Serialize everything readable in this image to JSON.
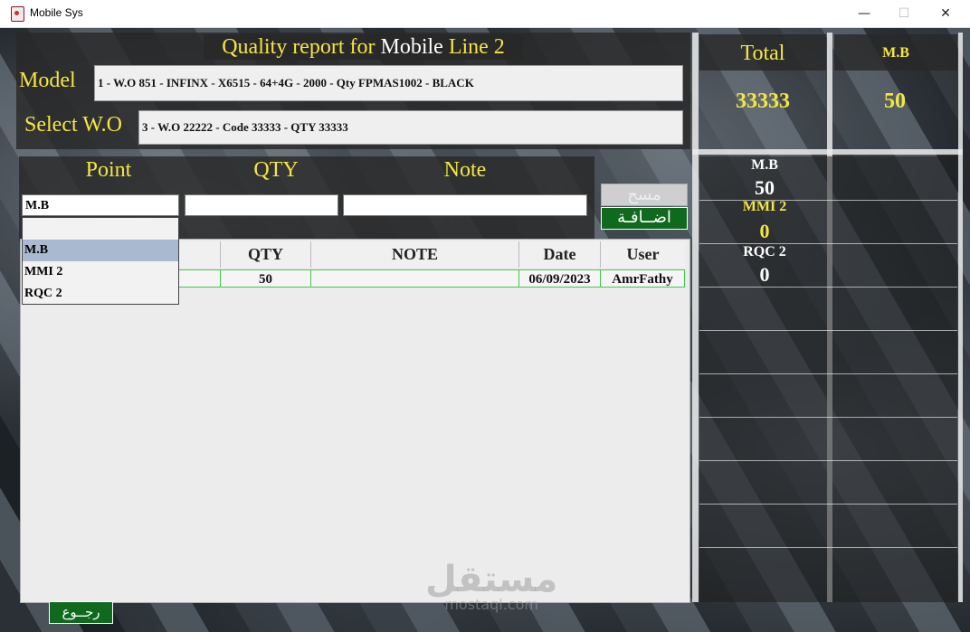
{
  "window": {
    "title": "Mobile Sys",
    "minimize": "—",
    "maximize": "☐",
    "close": "✕"
  },
  "header": {
    "part1": "Quality report for ",
    "part2": "Mobile",
    "part3": " Line 2"
  },
  "model": {
    "label": "Model",
    "value": "1 - W.O 851 -  INFINX - X6515 - 64+4G - 2000 - Qty FPMAS1002 - BLACK"
  },
  "wo": {
    "label": "Select W.O",
    "value": "3 - W.O 22222 - Code 33333 - QTY 33333"
  },
  "entry": {
    "point_label": "Point",
    "qty_label": "QTY",
    "note_label": "Note",
    "point_selected": "M.B",
    "options": [
      "M.B",
      "MMI 2",
      "RQC 2"
    ],
    "delete_button": "مسح",
    "add_button": "اضــافـة"
  },
  "grid": {
    "columns": [
      "QTY",
      "NOTE",
      "Date",
      "User"
    ],
    "rows": [
      {
        "qty": "50",
        "note": "",
        "date": "06/09/2023",
        "user": "AmrFathy"
      }
    ]
  },
  "totals": {
    "total_label": "Total",
    "total_value": "33333",
    "mb_label": "M.B",
    "mb_value": "50"
  },
  "points_summary": [
    {
      "label": "M.B",
      "value": "50"
    },
    {
      "label": "MMI 2",
      "value": "0"
    },
    {
      "label": "RQC 2",
      "value": "0"
    }
  ],
  "back_button": "رجــوع",
  "watermark": {
    "main": "مستقل",
    "sub": "mostaql.com"
  },
  "colors": {
    "accent_yellow": "#f5e642",
    "button_green": "#0f6a1e",
    "row_border": "#3ec94a"
  }
}
